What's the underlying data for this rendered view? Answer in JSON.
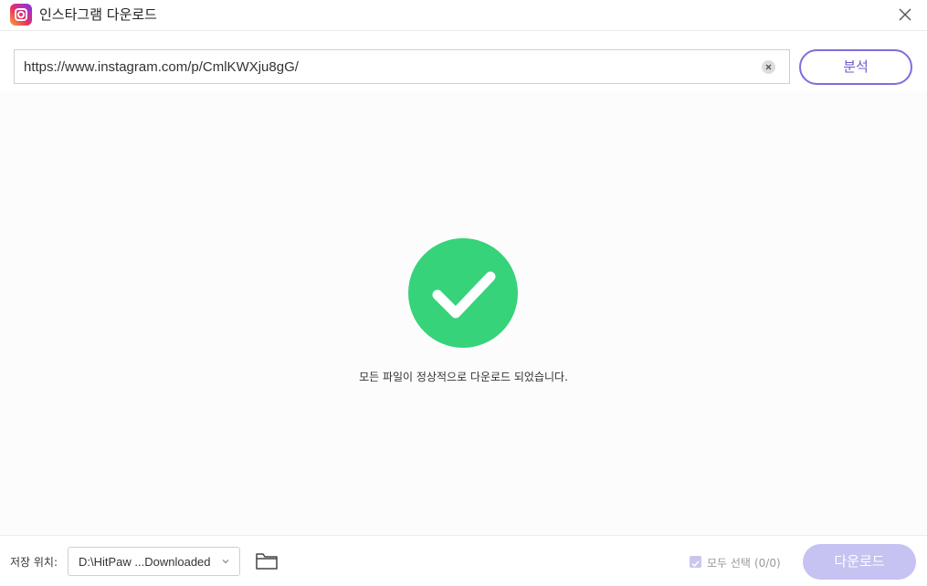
{
  "window": {
    "title": "인스타그램 다운로드",
    "app_icon": "instagram-icon",
    "close_icon": "close-icon"
  },
  "url_bar": {
    "value": "https://www.instagram.com/p/CmlKWXju8gG/",
    "clear_icon": "clear-icon",
    "analyze_label": "분석"
  },
  "main": {
    "status_icon": "check-circle-icon",
    "status_message": "모든 파일이 정상적으로 다운로드 되었습니다."
  },
  "footer": {
    "save_location_label": "저장 위치:",
    "save_path": "D:\\HitPaw ...Downloaded",
    "folder_icon": "folder-icon",
    "select_all_label": "모두 선택",
    "select_all_count": "(0/0)",
    "select_all_checked": true,
    "download_label": "다운로드"
  },
  "colors": {
    "accent": "#7b6fdc",
    "success": "#36d37a",
    "download_disabled": "#c6c2f2"
  }
}
